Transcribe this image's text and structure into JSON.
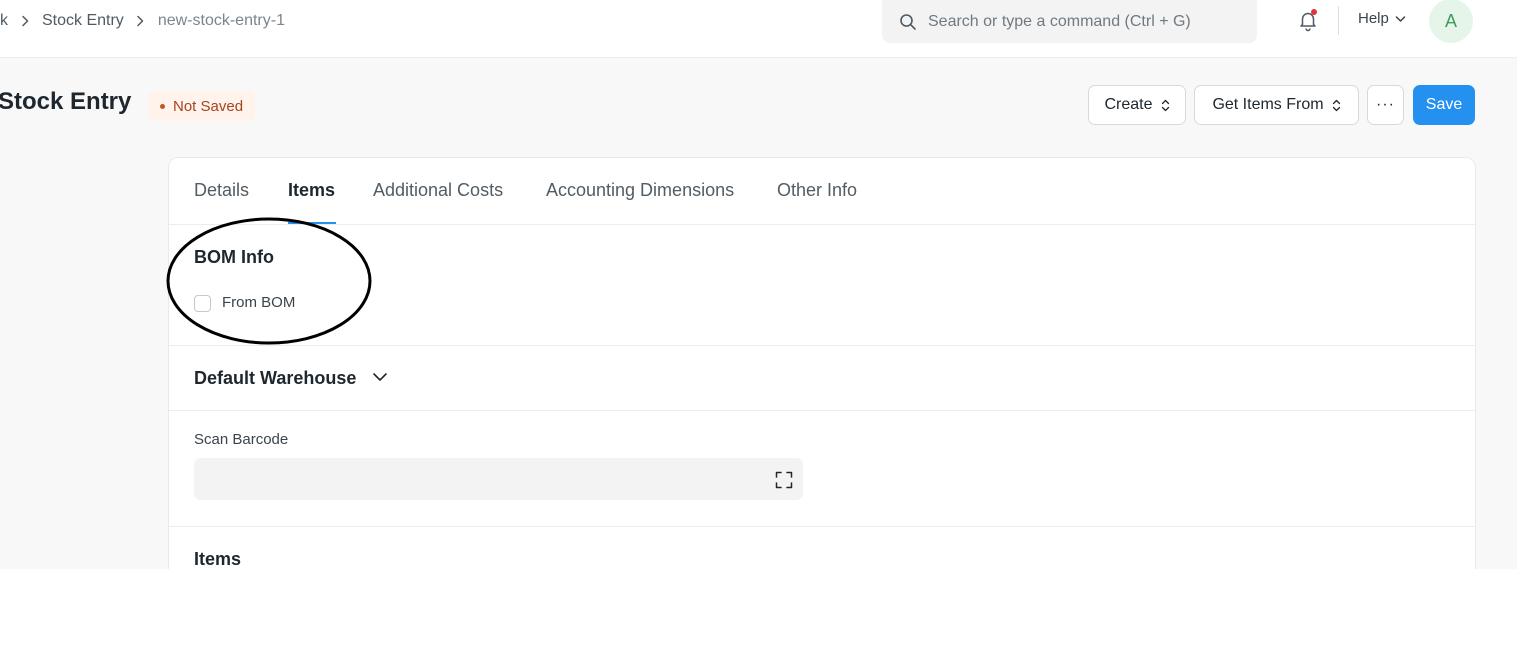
{
  "breadcrumb": {
    "items": [
      "ck",
      "Stock Entry",
      "new-stock-entry-1"
    ]
  },
  "search": {
    "placeholder": "Search or type a command (Ctrl + G)"
  },
  "navbar": {
    "help_label": "Help",
    "avatar_initial": "A",
    "notification_dot_color": "#e03636"
  },
  "page": {
    "title": "Stock Entry",
    "status": "Not Saved",
    "status_color": "#a3451d"
  },
  "actions": {
    "create_label": "Create",
    "get_items_label": "Get Items From",
    "more_label": "···",
    "save_label": "Save",
    "primary_color": "#2490ef"
  },
  "tabs": [
    {
      "label": "Details",
      "active": false
    },
    {
      "label": "Items",
      "active": true
    },
    {
      "label": "Additional Costs",
      "active": false
    },
    {
      "label": "Accounting Dimensions",
      "active": false
    },
    {
      "label": "Other Info",
      "active": false
    }
  ],
  "bom_info": {
    "title": "BOM Info",
    "from_bom_label": "From BOM",
    "from_bom_checked": false
  },
  "default_warehouse": {
    "title": "Default Warehouse",
    "collapsed": true
  },
  "scan_barcode": {
    "label": "Scan Barcode",
    "value": ""
  },
  "items_section": {
    "title": "Items"
  },
  "icons": [
    "chevron-right-icon",
    "search-icon",
    "bell-icon",
    "chevron-down-icon",
    "up-down-chevron-icon",
    "scan-icon"
  ]
}
